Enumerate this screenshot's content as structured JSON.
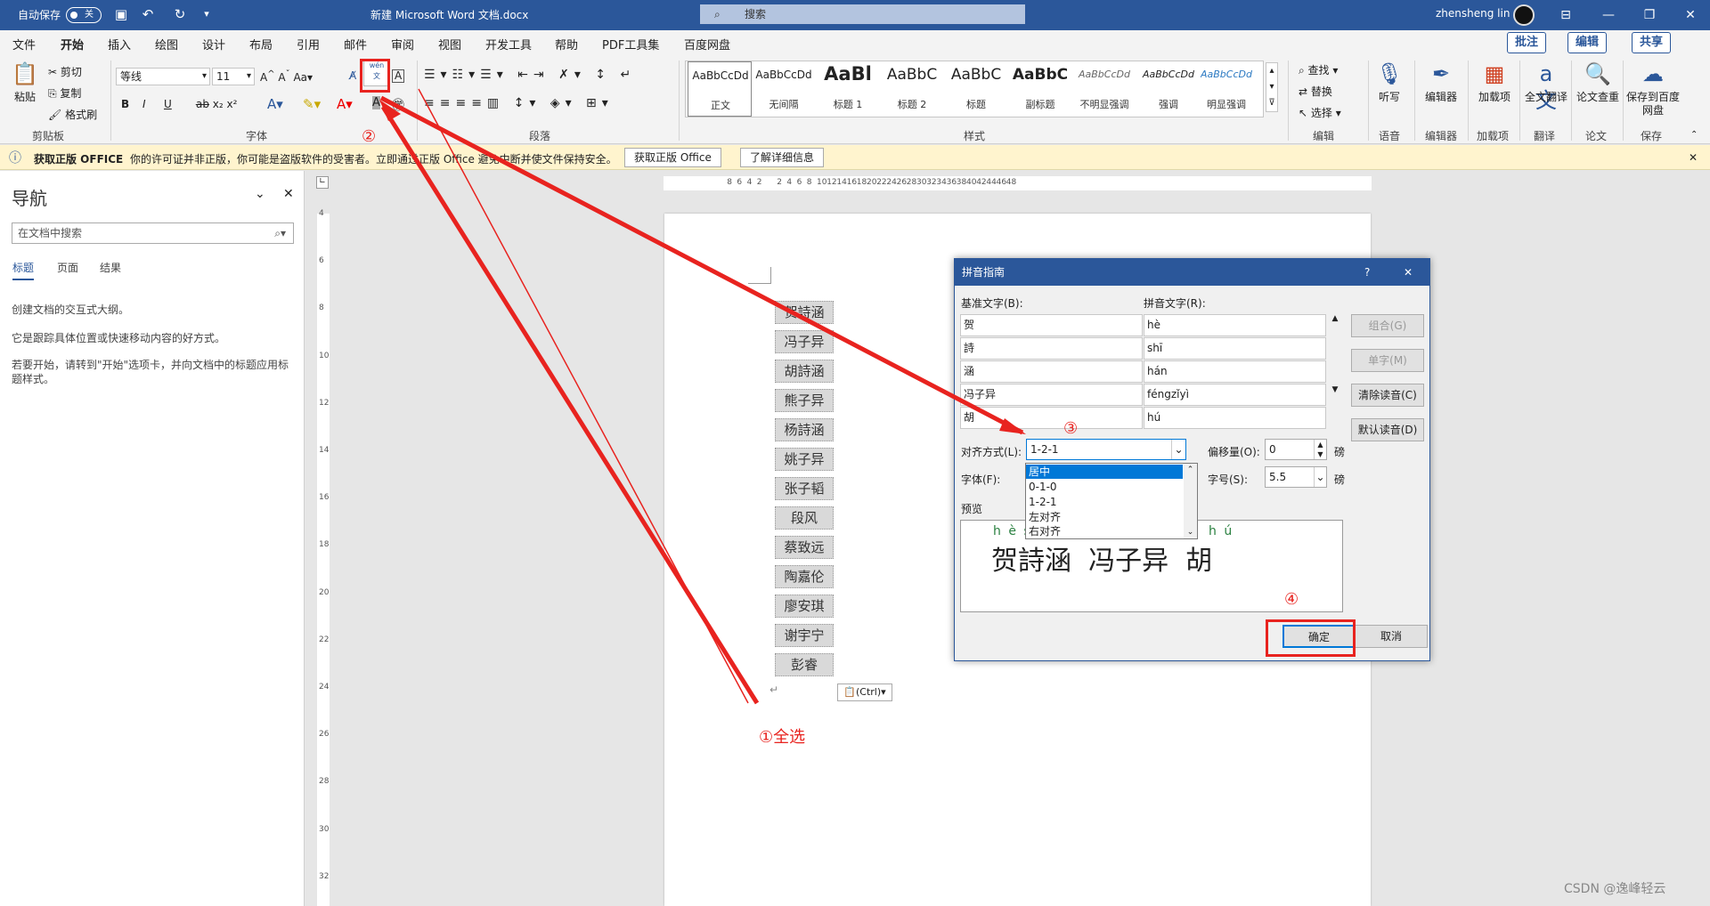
{
  "titlebar": {
    "autosave": "自动保存",
    "toggle": "关",
    "doc_title": "新建 Microsoft Word 文档.docx",
    "search": "搜索",
    "user": "zhensheng lin"
  },
  "menu": {
    "items": [
      "文件",
      "开始",
      "插入",
      "绘图",
      "设计",
      "布局",
      "引用",
      "邮件",
      "审阅",
      "视图",
      "开发工具",
      "帮助",
      "PDF工具集",
      "百度网盘"
    ],
    "comment": "批注",
    "edit": "编辑",
    "share": "共享"
  },
  "ribbon": {
    "clipboard": {
      "paste": "粘贴",
      "cut": "剪切",
      "copy": "复制",
      "format_painter": "格式刷",
      "group": "剪贴板"
    },
    "font": {
      "name": "等线",
      "size": "11",
      "group": "字体",
      "bold": "B",
      "italic": "I",
      "underline": "U"
    },
    "paragraph": {
      "group": "段落"
    },
    "styles": {
      "group": "样式",
      "items": [
        {
          "preview": "AaBbCcDd",
          "name": "正文"
        },
        {
          "preview": "AaBbCcDd",
          "name": "无间隔"
        },
        {
          "preview": "AaBl",
          "name": "标题 1"
        },
        {
          "preview": "AaBbC",
          "name": "标题 2"
        },
        {
          "preview": "AaBbC",
          "name": "标题"
        },
        {
          "preview": "AaBbC",
          "name": "副标题"
        },
        {
          "preview": "AaBbCcDd",
          "name": "不明显强调"
        },
        {
          "preview": "AaBbCcDd",
          "name": "强调"
        },
        {
          "preview": "AaBbCcDd",
          "name": "明显强调"
        }
      ]
    },
    "editing": {
      "find": "查找",
      "replace": "替换",
      "select": "选择",
      "group": "编辑"
    },
    "right_buttons": [
      {
        "label": "听写",
        "group": "语音"
      },
      {
        "label": "编辑器",
        "group": "编辑器"
      },
      {
        "label": "加载项",
        "group": "加载项"
      },
      {
        "label": "全文翻译",
        "group": "翻译"
      },
      {
        "label": "论文查重",
        "group": "论文"
      },
      {
        "label": "保存到百度网盘",
        "group": "保存"
      }
    ]
  },
  "infobar": {
    "title": "获取正版 OFFICE",
    "message": "你的许可证并非正版，你可能是盗版软件的受害者。立即通过正版 Office 避免中断并使文件保持安全。",
    "btn1": "获取正版 Office",
    "btn2": "了解详细信息"
  },
  "nav": {
    "title": "导航",
    "search_placeholder": "在文档中搜索",
    "tabs": [
      "标题",
      "页面",
      "结果"
    ],
    "p1": "创建文档的交互式大纲。",
    "p2": "它是跟踪具体位置或快速移动内容的好方式。",
    "p3": "若要开始，请转到\"开始\"选项卡，并向文档中的标题应用标题样式。"
  },
  "document": {
    "names": [
      "贺詩涵",
      "冯子异",
      "胡詩涵",
      "熊子异",
      "杨詩涵",
      "姚子异",
      "张子韬",
      "段风",
      "蔡致远",
      "陶嘉伦",
      "廖安琪",
      "谢宇宁",
      "彭睿"
    ],
    "paste_option": "(Ctrl)"
  },
  "dialog": {
    "title": "拼音指南",
    "base_label": "基准文字(B):",
    "ruby_label": "拼音文字(R):",
    "rows": [
      {
        "base": "贺",
        "ruby": "hè"
      },
      {
        "base": "詩",
        "ruby": "shī"
      },
      {
        "base": "涵",
        "ruby": "hán"
      },
      {
        "base": "冯子异",
        "ruby": "féngzǐyì"
      },
      {
        "base": "胡",
        "ruby": "hú"
      }
    ],
    "align_label": "对齐方式(L):",
    "align_value": "1-2-1",
    "offset_label": "偏移量(O):",
    "offset_value": "0",
    "offset_unit": "磅",
    "font_label": "字体(F):",
    "size_label": "字号(S):",
    "size_value": "5.5",
    "size_unit": "磅",
    "preview_label": "预览",
    "options": [
      "居中",
      "0-1-0",
      "1-2-1",
      "左对齐",
      "右对齐"
    ],
    "preview_ruby": "h è s",
    "preview_ruby2": "h ú",
    "preview_text": "贺詩涵  冯子异  胡",
    "buttons": {
      "group": "组合(G)",
      "single": "单字(M)",
      "clear": "清除读音(C)",
      "default": "默认读音(D)",
      "ok": "确定",
      "cancel": "取消"
    }
  },
  "annotations": {
    "a1": "①全选",
    "a2": "②",
    "a3": "③",
    "a4": "④"
  },
  "watermark": "CSDN @逸峰轻云",
  "colors": {
    "accent": "#2b579a",
    "annotation": "#e8231f"
  }
}
